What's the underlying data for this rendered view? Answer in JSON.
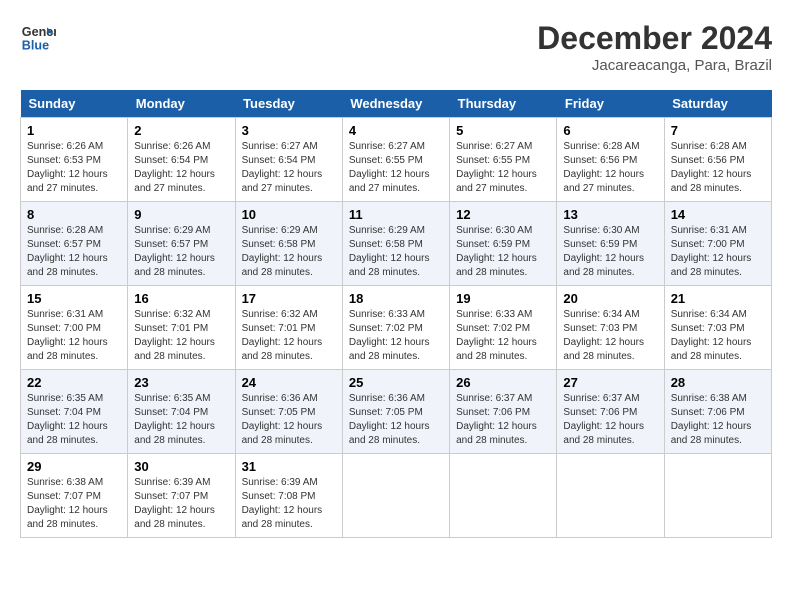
{
  "logo": {
    "line1": "General",
    "line2": "Blue"
  },
  "title": "December 2024",
  "subtitle": "Jacareacanga, Para, Brazil",
  "weekdays": [
    "Sunday",
    "Monday",
    "Tuesday",
    "Wednesday",
    "Thursday",
    "Friday",
    "Saturday"
  ],
  "weeks": [
    [
      {
        "day": "1",
        "sunrise": "6:26 AM",
        "sunset": "6:53 PM",
        "daylight": "12 hours and 27 minutes."
      },
      {
        "day": "2",
        "sunrise": "6:26 AM",
        "sunset": "6:54 PM",
        "daylight": "12 hours and 27 minutes."
      },
      {
        "day": "3",
        "sunrise": "6:27 AM",
        "sunset": "6:54 PM",
        "daylight": "12 hours and 27 minutes."
      },
      {
        "day": "4",
        "sunrise": "6:27 AM",
        "sunset": "6:55 PM",
        "daylight": "12 hours and 27 minutes."
      },
      {
        "day": "5",
        "sunrise": "6:27 AM",
        "sunset": "6:55 PM",
        "daylight": "12 hours and 27 minutes."
      },
      {
        "day": "6",
        "sunrise": "6:28 AM",
        "sunset": "6:56 PM",
        "daylight": "12 hours and 27 minutes."
      },
      {
        "day": "7",
        "sunrise": "6:28 AM",
        "sunset": "6:56 PM",
        "daylight": "12 hours and 28 minutes."
      }
    ],
    [
      {
        "day": "8",
        "sunrise": "6:28 AM",
        "sunset": "6:57 PM",
        "daylight": "12 hours and 28 minutes."
      },
      {
        "day": "9",
        "sunrise": "6:29 AM",
        "sunset": "6:57 PM",
        "daylight": "12 hours and 28 minutes."
      },
      {
        "day": "10",
        "sunrise": "6:29 AM",
        "sunset": "6:58 PM",
        "daylight": "12 hours and 28 minutes."
      },
      {
        "day": "11",
        "sunrise": "6:29 AM",
        "sunset": "6:58 PM",
        "daylight": "12 hours and 28 minutes."
      },
      {
        "day": "12",
        "sunrise": "6:30 AM",
        "sunset": "6:59 PM",
        "daylight": "12 hours and 28 minutes."
      },
      {
        "day": "13",
        "sunrise": "6:30 AM",
        "sunset": "6:59 PM",
        "daylight": "12 hours and 28 minutes."
      },
      {
        "day": "14",
        "sunrise": "6:31 AM",
        "sunset": "7:00 PM",
        "daylight": "12 hours and 28 minutes."
      }
    ],
    [
      {
        "day": "15",
        "sunrise": "6:31 AM",
        "sunset": "7:00 PM",
        "daylight": "12 hours and 28 minutes."
      },
      {
        "day": "16",
        "sunrise": "6:32 AM",
        "sunset": "7:01 PM",
        "daylight": "12 hours and 28 minutes."
      },
      {
        "day": "17",
        "sunrise": "6:32 AM",
        "sunset": "7:01 PM",
        "daylight": "12 hours and 28 minutes."
      },
      {
        "day": "18",
        "sunrise": "6:33 AM",
        "sunset": "7:02 PM",
        "daylight": "12 hours and 28 minutes."
      },
      {
        "day": "19",
        "sunrise": "6:33 AM",
        "sunset": "7:02 PM",
        "daylight": "12 hours and 28 minutes."
      },
      {
        "day": "20",
        "sunrise": "6:34 AM",
        "sunset": "7:03 PM",
        "daylight": "12 hours and 28 minutes."
      },
      {
        "day": "21",
        "sunrise": "6:34 AM",
        "sunset": "7:03 PM",
        "daylight": "12 hours and 28 minutes."
      }
    ],
    [
      {
        "day": "22",
        "sunrise": "6:35 AM",
        "sunset": "7:04 PM",
        "daylight": "12 hours and 28 minutes."
      },
      {
        "day": "23",
        "sunrise": "6:35 AM",
        "sunset": "7:04 PM",
        "daylight": "12 hours and 28 minutes."
      },
      {
        "day": "24",
        "sunrise": "6:36 AM",
        "sunset": "7:05 PM",
        "daylight": "12 hours and 28 minutes."
      },
      {
        "day": "25",
        "sunrise": "6:36 AM",
        "sunset": "7:05 PM",
        "daylight": "12 hours and 28 minutes."
      },
      {
        "day": "26",
        "sunrise": "6:37 AM",
        "sunset": "7:06 PM",
        "daylight": "12 hours and 28 minutes."
      },
      {
        "day": "27",
        "sunrise": "6:37 AM",
        "sunset": "7:06 PM",
        "daylight": "12 hours and 28 minutes."
      },
      {
        "day": "28",
        "sunrise": "6:38 AM",
        "sunset": "7:06 PM",
        "daylight": "12 hours and 28 minutes."
      }
    ],
    [
      {
        "day": "29",
        "sunrise": "6:38 AM",
        "sunset": "7:07 PM",
        "daylight": "12 hours and 28 minutes."
      },
      {
        "day": "30",
        "sunrise": "6:39 AM",
        "sunset": "7:07 PM",
        "daylight": "12 hours and 28 minutes."
      },
      {
        "day": "31",
        "sunrise": "6:39 AM",
        "sunset": "7:08 PM",
        "daylight": "12 hours and 28 minutes."
      },
      null,
      null,
      null,
      null
    ]
  ],
  "labels": {
    "sunrise": "Sunrise:",
    "sunset": "Sunset:",
    "daylight": "Daylight:"
  }
}
